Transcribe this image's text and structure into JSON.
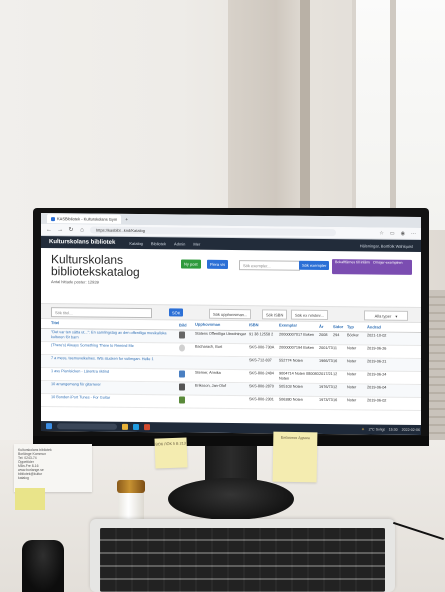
{
  "browser": {
    "tab_label": "KASBibliotek - Kulturskolans Gym",
    "url": "https://kasbibl...knd/Katalog"
  },
  "app": {
    "brand": "Kulturskolans bibliotek",
    "nav": [
      "Katalog",
      "Bibliotek",
      "Admin",
      "Mer"
    ],
    "user": "Hälsningar, Bortfolk Wahlquist"
  },
  "header": {
    "title": "Kulturskolans bibliotekskatalog",
    "subtitle": "Antal hittade poster: 12939",
    "btn_new": "Ny post",
    "btn_more": "Flera vis",
    "search_placeholder": "Sök exempler...",
    "btn_search_ex": "Sök exempler",
    "btn_purple1": "Bokaftfärnes till inlåmningar",
    "btn_purple2": "Omsjer-exemplren"
  },
  "filters": {
    "search_placeholder": "Sök titel...",
    "btn_sok": "SÖK",
    "btn_upphovsman": "Sök upphovsman...",
    "btn_isbn": "Sök ISBN",
    "btn_exnr": "Sök ex nr/stmr...",
    "btn_types": "Alla typer"
  },
  "table": {
    "headers": [
      "Titel",
      "Bild",
      "Upphovsman",
      "ISBN",
      "Exemplar",
      "År",
      "Sidor",
      "Typ",
      "Ändrad"
    ],
    "rows": [
      {
        "title": "\"Det var ten sätta ut...\": En samlingstag av den offentliga musikaliska kulturen för barn",
        "upp": "Statens Offentliga Utredningar",
        "isbn": "91 38 12558 2",
        "ex": "20000007017 Boken",
        "ar": "2008",
        "sid": "294",
        "typ": "Böcker",
        "andrad": "2021-10-02"
      },
      {
        "title": "(There's) Always Something There to Remind Me",
        "upp": "Bacharach, Burt",
        "isbn": "SKS-000-730A",
        "ex": "20000007194 Boken",
        "ar": "2001/73",
        "sid": "11",
        "typ": "Noter",
        "andrad": "2019-06-26"
      },
      {
        "title": "7 a mess, teemuvelkelnes. Wts stucken for vutimgan. Helle 1",
        "upp": "",
        "isbn": "SKS-712-837",
        "ex": "552774 Noten",
        "ar": "1966/73",
        "sid": "16",
        "typ": "Noter",
        "andrad": "2019-06-21"
      },
      {
        "title": "1 ass Pianisicken - Lärentra riktind",
        "upp": "Sterner, Annika",
        "isbn": "SKS-800-2484",
        "ex": "9004714 Noten 080080 Noten",
        "ar": "2017/21",
        "sid": "12",
        "typ": "Noter",
        "andrad": "2019-06-24"
      },
      {
        "title": "10 arrangemang för gitarrerer",
        "upp": "Eriksson, Jan-Olof",
        "isbn": "SKS-800-2870",
        "ex": "505103 Noten",
        "ar": "1976/73",
        "sid": "12",
        "typ": "Noter",
        "andrad": "2019-06-04"
      },
      {
        "title": "10 Bonden iPort Tunes - For Guitar",
        "upp": "",
        "isbn": "SKS-800-2301",
        "ex": "506380 Noten",
        "ar": "1973/73",
        "sid": "16",
        "typ": "Noter",
        "andrad": "2019-06-02"
      }
    ]
  },
  "taskbar": {
    "weather": "2°C Soligt",
    "time": "15:30",
    "date": "2022-02-06"
  },
  "notes": {
    "postit_left": "ВОК ЛОК\n5 B 213",
    "postit_right": "Бибиотек\nАдмин",
    "paper_text": "Kulturskolans bibliotek\nBorlänge Kommun\nTel: 0243-74\nÖppettider\nMån-Fre 8-16\nwww.borlange.se\nbibliotek@kultur\nkatalog"
  },
  "colors": {
    "nav_bg": "#222c3a",
    "btn_green": "#2f9a3c",
    "btn_blue": "#2b6fd6",
    "btn_purple": "#7b4db1",
    "link": "#2f6fb5"
  },
  "icons": [
    "tab-icon",
    "back-icon",
    "refresh-icon",
    "home-icon",
    "windows-icon",
    "search-icon",
    "weather-icon"
  ]
}
